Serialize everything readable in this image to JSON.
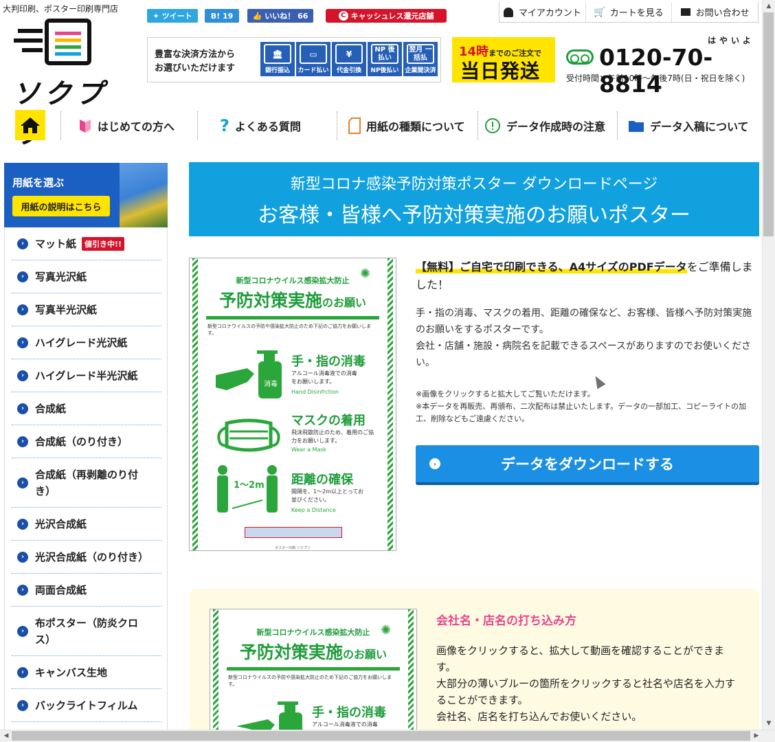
{
  "header": {
    "tagline": "大判印刷、ポスター印刷専門店",
    "logo_text": "ソクプリ",
    "social": {
      "tweet": "ツイート",
      "hatena": "B! 19",
      "like": "いいね！ 66",
      "cashless": "キャッシュレス還元店舗",
      "cashless_mark": "C"
    },
    "toplinks": {
      "account": "マイアカウント",
      "cart": "カートを見る",
      "contact": "お問い合わせ"
    },
    "payment": {
      "text_line1": "豊富な決済方法から",
      "text_line2": "お選びいただけます",
      "methods": [
        {
          "label": "銀行振込",
          "icon": "bank-icon"
        },
        {
          "label": "カード払い",
          "icon": "card-icon"
        },
        {
          "label": "代金引換",
          "icon": "cod-icon"
        },
        {
          "label": "NP後払い",
          "icon": "np-icon",
          "mark": "NP 後払い"
        },
        {
          "label": "企業間決済",
          "icon": "invoice-icon",
          "mark": "翌月 一括払"
        }
      ]
    },
    "sameday": {
      "hour": "14時",
      "cond": "までのご注文で",
      "main": "当日発送"
    },
    "tel": {
      "ruby": "はやいよ",
      "number": "0120-70-8814",
      "hours": "受付時間：午前10時〜午後7時(日・祝日を除く)"
    }
  },
  "nav": {
    "items": [
      {
        "label": "はじめての方へ",
        "icon": "beginner-icon"
      },
      {
        "label": "よくある質問",
        "icon": "question-icon"
      },
      {
        "label": "用紙の種類について",
        "icon": "paper-icon"
      },
      {
        "label": "データ作成時の注意",
        "icon": "alert-icon"
      },
      {
        "label": "データ入稿について",
        "icon": "folder-icon"
      }
    ]
  },
  "sidebar": {
    "title": "用紙を選ぶ",
    "explain_button": "用紙の説明はこちら",
    "sale_badge": "値引き中!!",
    "items": [
      {
        "label": "マット紙"
      },
      {
        "label": "写真光沢紙"
      },
      {
        "label": "写真半光沢紙"
      },
      {
        "label": "ハイグレード光沢紙"
      },
      {
        "label": "ハイグレード半光沢紙"
      },
      {
        "label": "合成紙"
      },
      {
        "label": "合成紙（のり付き）"
      },
      {
        "label": "合成紙（再剥離のり付き）"
      },
      {
        "label": "光沢合成紙"
      },
      {
        "label": "光沢合成紙（のり付き）"
      },
      {
        "label": "両面合成紙"
      },
      {
        "label": "布ポスター（防炎クロス）"
      },
      {
        "label": "キャンバス生地"
      },
      {
        "label": "バックライトフィルム"
      }
    ]
  },
  "banner": {
    "sub": "新型コロナ感染予防対策ポスター ダウンロードページ",
    "main": "お客様・皆様へ予防対策実施のお願いポスター"
  },
  "poster": {
    "sub": "新型コロナウイルス感染拡大防止",
    "title_main": "予防対策実施",
    "title_suffix": "のお願い",
    "note": "新型コロナウイルスの予防や感染拡大防止のため下記のご協力をお願いします。",
    "sections": [
      {
        "heading": "手・指の消毒",
        "text": "アルコール消毒液での消毒をお願いします。",
        "en": "Hand Disinfrction"
      },
      {
        "heading": "マスクの着用",
        "text": "飛沫飛散防止のため、着用のご協力をお願いします。",
        "en": "Wear a Mask"
      },
      {
        "heading": "距離の確保",
        "text": "間隔を、1〜2m以上とってお並びください。",
        "en": "Keep a Distance"
      }
    ],
    "bottle_label": "消毒",
    "distance_label": "1〜2m",
    "footer": "ポスター印刷 ソクプリ"
  },
  "intro": {
    "highlight": "【無料】ご自宅で印刷できる、A4サイズのPDFデータ",
    "highlight_tail": "をご準備しました！",
    "body1": "手・指の消毒、マスクの着用、距離の確保など、お客様、皆様へ予防対策実施のお願いをするポスターです。",
    "body2": "会社・店舗・施設・病院名を記載できるスペースがありますのでお使いください。",
    "note1": "※画像をクリックすると拡大してご覧いただけます。",
    "note2": "※本データを再販売、再頒布、二次配布は禁止いたします。データの一部加工、コピーライトの加工、削除などもご遠慮ください。"
  },
  "download_button": "データをダウンロードする",
  "howto": {
    "title": "会社名・店名の打ち込み方",
    "line1": "画像をクリックすると、拡大して動画を確認することができます。",
    "line2": "大部分の薄いブルーの箇所をクリックすると社名や店名を入力することができます。",
    "line3": "会社名、店名を打ち込んでお使いください。"
  },
  "colors": {
    "accent_blue": "#10a1de",
    "brand_yellow": "#ffe400",
    "poster_green": "#2aa63a",
    "nav_blue": "#1a5fc1",
    "pink": "#e8458b"
  }
}
